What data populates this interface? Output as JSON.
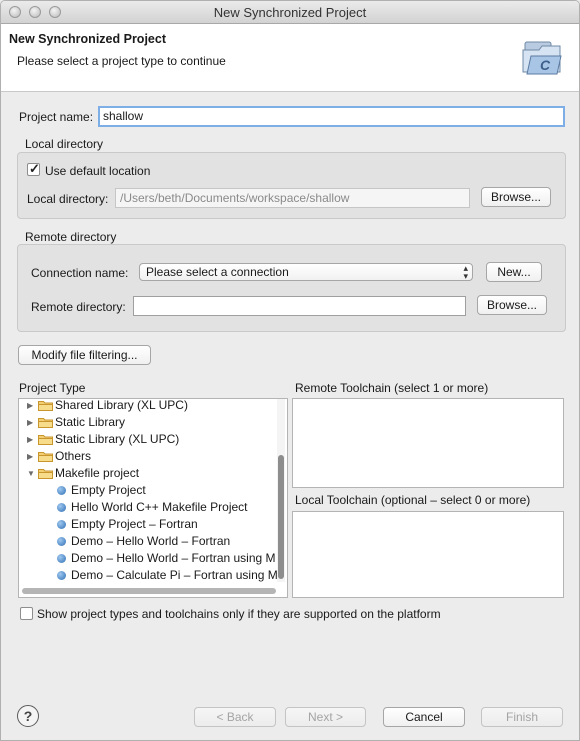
{
  "window": {
    "title": "New Synchronized Project"
  },
  "banner": {
    "title": "New Synchronized Project",
    "subtitle": "Please select a project type to continue",
    "icon": "c-project-folder-icon"
  },
  "project_name": {
    "label": "Project name:",
    "value": "shallow"
  },
  "local_directory": {
    "group_label": "Local directory",
    "use_default_label": "Use default location",
    "use_default_checked": true,
    "dir_label": "Local directory:",
    "dir_value": "/Users/beth/Documents/workspace/shallow",
    "browse_label": "Browse..."
  },
  "remote_directory": {
    "group_label": "Remote directory",
    "connection_label": "Connection name:",
    "connection_value": "Please select a connection",
    "new_label": "New...",
    "dir_label": "Remote directory:",
    "dir_value": "",
    "browse_label": "Browse..."
  },
  "modify_filtering_label": "Modify file filtering...",
  "project_type": {
    "label": "Project Type",
    "items": [
      {
        "label": "Shared Library (XL UPC)",
        "kind": "folder",
        "expanded": false
      },
      {
        "label": "Static Library",
        "kind": "folder",
        "expanded": false
      },
      {
        "label": "Static Library (XL UPC)",
        "kind": "folder",
        "expanded": false
      },
      {
        "label": "Others",
        "kind": "folder",
        "expanded": false
      },
      {
        "label": "Makefile project",
        "kind": "folder",
        "expanded": true
      },
      {
        "label": "Empty Project",
        "kind": "item"
      },
      {
        "label": "Hello World C++ Makefile Project",
        "kind": "item"
      },
      {
        "label": "Empty Project – Fortran",
        "kind": "item"
      },
      {
        "label": "Demo – Hello World – Fortran",
        "kind": "item"
      },
      {
        "label": "Demo – Hello World – Fortran using M",
        "kind": "item"
      },
      {
        "label": "Demo – Calculate Pi – Fortran using M",
        "kind": "item"
      }
    ]
  },
  "remote_toolchain": {
    "label": "Remote Toolchain (select 1 or more)"
  },
  "local_toolchain": {
    "label": "Local Toolchain (optional – select 0 or more)"
  },
  "show_supported": {
    "label": "Show project types and toolchains only if they are supported on the platform",
    "checked": false
  },
  "footer": {
    "help_icon": "help-icon",
    "back_label": "< Back",
    "next_label": "Next >",
    "cancel_label": "Cancel",
    "finish_label": "Finish"
  }
}
